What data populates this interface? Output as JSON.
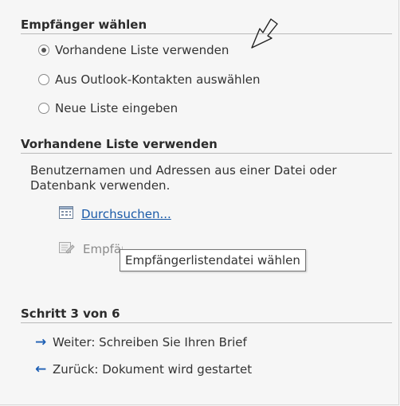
{
  "section1": {
    "heading": "Empfänger wählen",
    "options": [
      {
        "label": "Vorhandene Liste verwenden",
        "checked": true
      },
      {
        "label": "Aus Outlook-Kontakten auswählen",
        "checked": false
      },
      {
        "label": "Neue Liste eingeben",
        "checked": false
      }
    ]
  },
  "section2": {
    "heading": "Vorhandene Liste verwenden",
    "description": "Benutzernamen und Adressen aus einer Datei oder Datenbank verwenden.",
    "browse_label": "Durchsuchen...",
    "edit_label": "Empfängerliste bearbeiten..."
  },
  "tooltip": "Empfängerlistendatei wählen",
  "section3": {
    "heading": "Schritt 3 von 6",
    "next_label": "Weiter: Schreiben Sie Ihren Brief",
    "back_label": "Zurück: Dokument wird gestartet"
  },
  "colors": {
    "link": "#1a5aa8",
    "arrow": "#1d5fb4"
  }
}
